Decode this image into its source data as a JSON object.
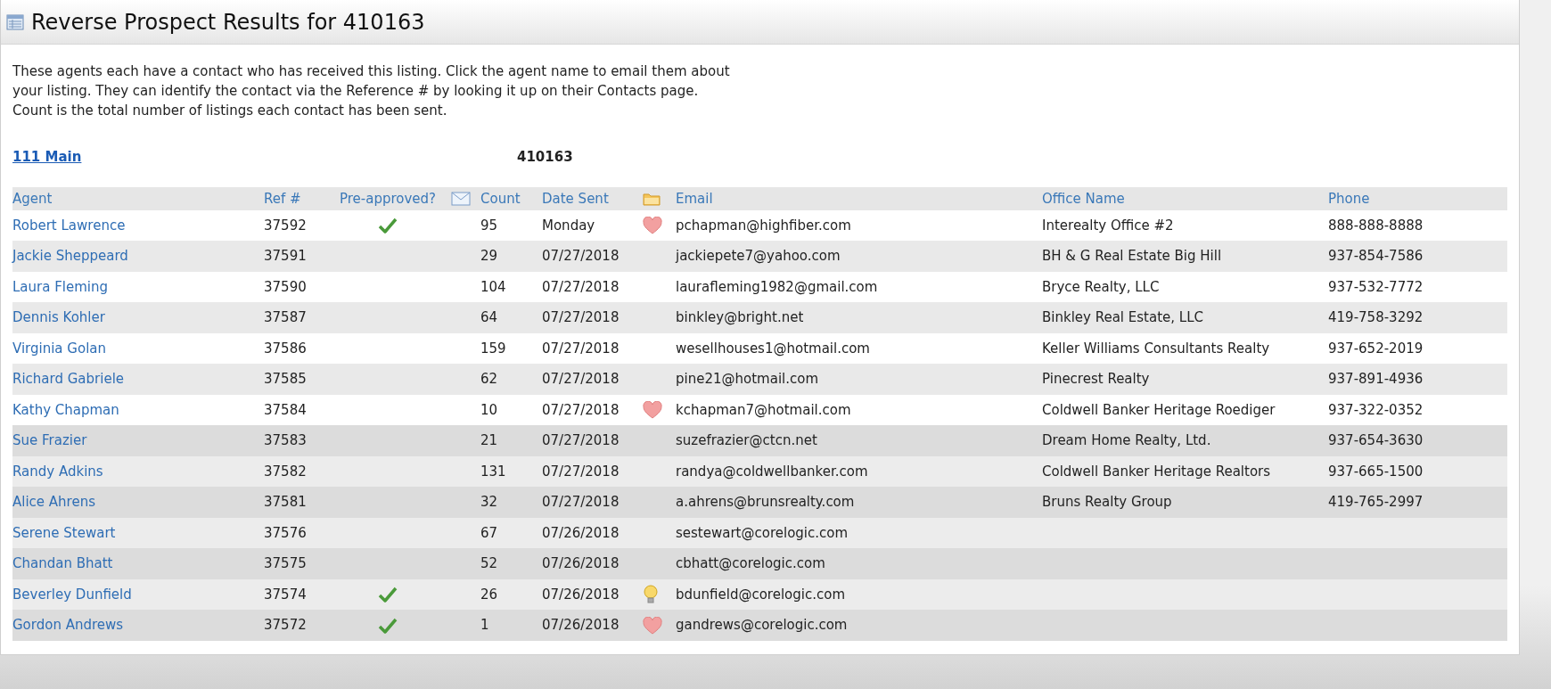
{
  "panel": {
    "title": "Reverse Prospect Results for 410163"
  },
  "intro": [
    "These agents each have a contact who has received this listing. Click the agent name to email them about",
    "your listing. They can identify the contact via the Reference # by looking it up on their Contacts page.",
    "Count is the total number of listings each contact has been sent."
  ],
  "listing": {
    "address": "111 Main",
    "number": "410163"
  },
  "table": {
    "columns": [
      "Agent",
      "Ref #",
      "Pre-approved?",
      "Count",
      "Date Sent",
      "Email",
      "Office Name",
      "Phone"
    ],
    "rows": [
      {
        "agent": "Robert Lawrence",
        "ref": "37592",
        "pre_approved": true,
        "count": "95",
        "date_sent": "Monday",
        "status_icon": {
          "kind": "heart"
        },
        "email": "pchapman@highfiber.com",
        "office": "Interealty Office #2",
        "phone": "888-888-8888"
      },
      {
        "agent": "Jackie Sheppeard",
        "ref": "37591",
        "pre_approved": false,
        "count": "29",
        "date_sent": "07/27/2018",
        "email": "jackiepete7@yahoo.com",
        "office": "BH & G Real Estate Big Hill",
        "phone": "937-854-7586"
      },
      {
        "agent": "Laura Fleming",
        "ref": "37590",
        "pre_approved": false,
        "count": "104",
        "date_sent": "07/27/2018",
        "email": "laurafleming1982@gmail.com",
        "office": "Bryce Realty, LLC",
        "phone": "937-532-7772"
      },
      {
        "agent": "Dennis Kohler",
        "ref": "37587",
        "pre_approved": false,
        "count": "64",
        "date_sent": "07/27/2018",
        "email": "binkley@bright.net",
        "office": "Binkley Real Estate, LLC",
        "phone": "419-758-3292"
      },
      {
        "agent": "Virginia Golan",
        "ref": "37586",
        "pre_approved": false,
        "count": "159",
        "date_sent": "07/27/2018",
        "email": "wesellhouses1@hotmail.com",
        "office": "Keller Williams Consultants Realty",
        "phone": "937-652-2019"
      },
      {
        "agent": "Richard Gabriele",
        "ref": "37585",
        "pre_approved": false,
        "count": "62",
        "date_sent": "07/27/2018",
        "email": "pine21@hotmail.com",
        "office": "Pinecrest Realty",
        "phone": "937-891-4936"
      },
      {
        "agent": "Kathy Chapman",
        "ref": "37584",
        "pre_approved": false,
        "count": "10",
        "date_sent": "07/27/2018",
        "status_icon": {
          "kind": "heart"
        },
        "email": "kchapman7@hotmail.com",
        "office": "Coldwell Banker Heritage Roediger",
        "phone": "937-322-0352"
      },
      {
        "agent": "Sue Frazier",
        "ref": "37583",
        "pre_approved": false,
        "count": "21",
        "date_sent": "07/27/2018",
        "email": "suzefrazier@ctcn.net",
        "office": "Dream Home Realty, Ltd.",
        "phone": "937-654-3630"
      },
      {
        "agent": "Randy Adkins",
        "ref": "37582",
        "pre_approved": false,
        "count": "131",
        "date_sent": "07/27/2018",
        "email": "randya@coldwellbanker.com",
        "office": "Coldwell Banker Heritage Realtors",
        "phone": "937-665-1500"
      },
      {
        "agent": "Alice Ahrens",
        "ref": "37581",
        "pre_approved": false,
        "count": "32",
        "date_sent": "07/27/2018",
        "email": "a.ahrens@brunsrealty.com",
        "office": "Bruns Realty Group",
        "phone": "419-765-2997"
      },
      {
        "agent": "Serene Stewart",
        "ref": "37576",
        "pre_approved": false,
        "count": "67",
        "date_sent": "07/26/2018",
        "email": "sestewart@corelogic.com"
      },
      {
        "agent": "Chandan Bhatt",
        "ref": "37575",
        "pre_approved": false,
        "count": "52",
        "date_sent": "07/26/2018",
        "email": "cbhatt@corelogic.com"
      },
      {
        "agent": "Beverley Dunfield",
        "ref": "37574",
        "pre_approved": true,
        "count": "26",
        "date_sent": "07/26/2018",
        "status_icon": {
          "kind": "bulb"
        },
        "email": "bdunfield@corelogic.com"
      },
      {
        "agent": "Gordon Andrews",
        "ref": "37572",
        "pre_approved": true,
        "count": "1",
        "date_sent": "07/26/2018",
        "status_icon": {
          "kind": "heart"
        },
        "email": "gandrews@corelogic.com"
      }
    ]
  }
}
